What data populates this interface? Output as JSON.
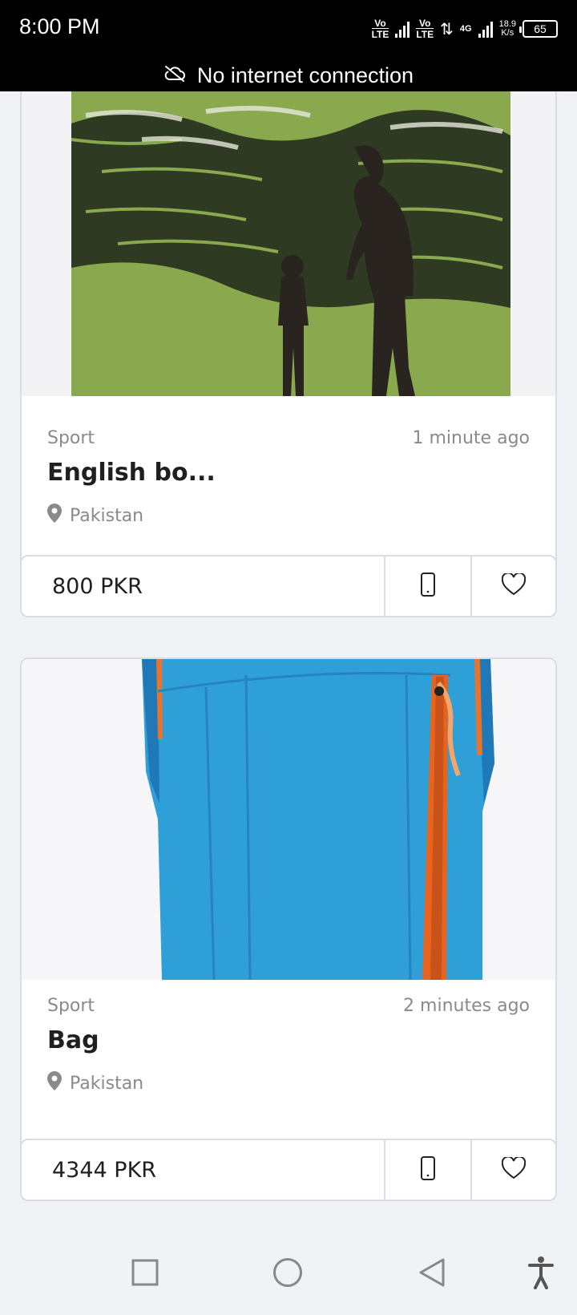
{
  "status_bar": {
    "time": "8:00 PM",
    "volte1_top": "Vo",
    "volte1_bottom": "LTE",
    "volte2_top": "Vo",
    "volte2_bottom": "LTE",
    "network_type": "4G",
    "speed_value": "18.9",
    "speed_unit": "K/s",
    "battery": "65"
  },
  "banner": {
    "icon": "cloud-off-icon",
    "text": "No internet connection"
  },
  "listings": [
    {
      "category": "Sport",
      "time_ago": "1 minute ago",
      "title": "English bo...",
      "location": "Pakistan",
      "price": "800 PKR",
      "image_description": "book-cover-silhouettes"
    },
    {
      "category": "Sport",
      "time_ago": "2 minutes ago",
      "title": "Bag",
      "location": "Pakistan",
      "price": "4344 PKR",
      "image_description": "blue-bag"
    }
  ],
  "colors": {
    "background": "#f1f2f6",
    "card_border": "#dcdde3",
    "muted_text": "#8a8a8a",
    "title_text": "#1f1f1f"
  },
  "nav": {
    "recents_icon": "square-icon",
    "home_icon": "circle-icon",
    "back_icon": "triangle-back-icon",
    "accessibility_icon": "accessibility-icon"
  }
}
